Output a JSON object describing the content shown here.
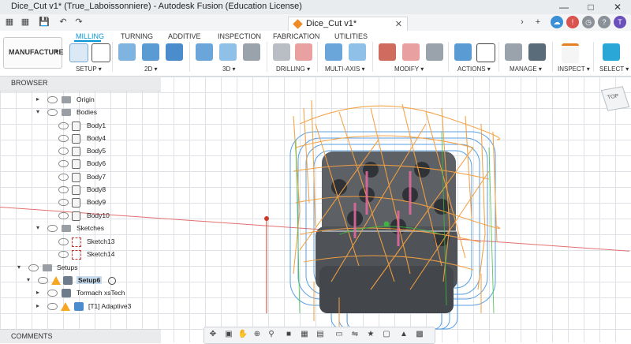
{
  "window": {
    "title": "Dice_Cut v1* (True_Laboissonniere) - Autodesk Fusion (Education License)"
  },
  "doc_tab": {
    "label": "Dice_Cut v1*"
  },
  "workspace": {
    "label": "MANUFACTURE"
  },
  "tabs": [
    "MILLING",
    "TURNING",
    "ADDITIVE",
    "INSPECTION",
    "FABRICATION",
    "UTILITIES"
  ],
  "groups": [
    "SETUP ▾",
    "2D ▾",
    "3D ▾",
    "DRILLING ▾",
    "MULTI-AXIS ▾",
    "MODIFY ▾",
    "ACTIONS ▾",
    "MANAGE ▾",
    "INSPECT ▾",
    "SELECT ▾"
  ],
  "browser": {
    "header": "BROWSER",
    "items": [
      "Origin",
      "Bodies",
      "Body1",
      "Body4",
      "Body5",
      "Body6",
      "Body7",
      "Body8",
      "Body9",
      "Body10",
      "Sketches",
      "Sketch13",
      "Sketch14",
      "Setups",
      "Setup6",
      "Tormach xsTech",
      "[T1] Adaptive3"
    ]
  },
  "comments": {
    "label": "COMMENTS"
  },
  "viewcube": {
    "label": "TOP"
  },
  "colors": {
    "accent": "#0696d7",
    "toolpath_orange": "#f5a040",
    "toolpath_blue": "#3a8fe0",
    "toolpath_green": "#3cc03c"
  },
  "icons": [
    "app-icon",
    "grid-icon",
    "save-icon",
    "undo-icon",
    "redo-icon",
    "plus-icon",
    "notifications-icon",
    "help-icon",
    "profile-icon"
  ]
}
